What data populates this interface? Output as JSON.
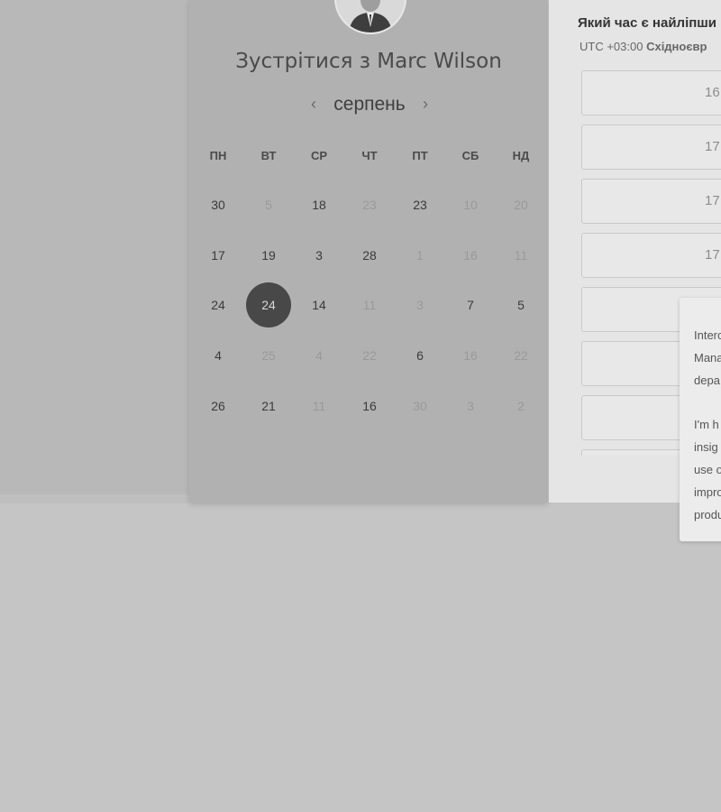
{
  "header": {
    "title": "Зустрітися з Marc Wilson"
  },
  "calendar": {
    "month": "серпень",
    "prev_icon": "‹",
    "next_icon": "›",
    "weekdays": [
      "ПН",
      "ВТ",
      "СР",
      "ЧТ",
      "ПТ",
      "СБ",
      "НД"
    ],
    "weeks": [
      [
        {
          "d": "30",
          "s": "active"
        },
        {
          "d": "5",
          "s": "muted"
        },
        {
          "d": "18",
          "s": "active"
        },
        {
          "d": "23",
          "s": "muted"
        },
        {
          "d": "23",
          "s": "active"
        },
        {
          "d": "10",
          "s": "muted"
        },
        {
          "d": "20",
          "s": "muted"
        }
      ],
      [
        {
          "d": "17",
          "s": "active"
        },
        {
          "d": "19",
          "s": "active"
        },
        {
          "d": "3",
          "s": "active"
        },
        {
          "d": "28",
          "s": "active"
        },
        {
          "d": "1",
          "s": "muted"
        },
        {
          "d": "16",
          "s": "muted"
        },
        {
          "d": "11",
          "s": "muted"
        }
      ],
      [
        {
          "d": "24",
          "s": "active"
        },
        {
          "d": "24",
          "s": "selected"
        },
        {
          "d": "14",
          "s": "active"
        },
        {
          "d": "11",
          "s": "muted"
        },
        {
          "d": "3",
          "s": "muted"
        },
        {
          "d": "7",
          "s": "active"
        },
        {
          "d": "5",
          "s": "active"
        }
      ],
      [
        {
          "d": "4",
          "s": "active"
        },
        {
          "d": "25",
          "s": "muted"
        },
        {
          "d": "4",
          "s": "muted"
        },
        {
          "d": "22",
          "s": "muted"
        },
        {
          "d": "6",
          "s": "active"
        },
        {
          "d": "16",
          "s": "muted"
        },
        {
          "d": "22",
          "s": "muted"
        }
      ],
      [
        {
          "d": "26",
          "s": "active"
        },
        {
          "d": "21",
          "s": "active"
        },
        {
          "d": "11",
          "s": "muted"
        },
        {
          "d": "16",
          "s": "active"
        },
        {
          "d": "30",
          "s": "muted"
        },
        {
          "d": "3",
          "s": "muted"
        },
        {
          "d": "2",
          "s": "muted"
        }
      ]
    ]
  },
  "times": {
    "question": "Який час є найліпши",
    "timezone_prefix": "UTC +03:00",
    "timezone_name": "Східноєвр",
    "slots": [
      "16",
      "17",
      "17",
      "17",
      "",
      "",
      "",
      ""
    ]
  },
  "tooltip": {
    "lines": [
      "Interc",
      "Mana",
      "depa",
      "",
      "I'm h",
      "insig",
      "use o",
      "impro",
      "produ"
    ]
  }
}
